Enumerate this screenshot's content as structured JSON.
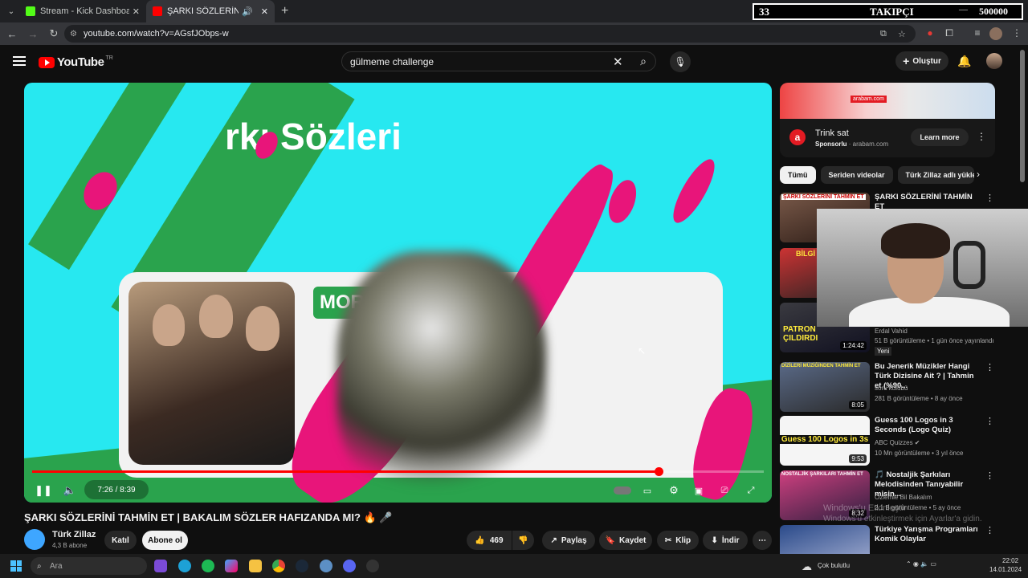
{
  "browser": {
    "tabs": [
      {
        "title": "Stream - Kick Dashboard",
        "color": "#53fc18"
      },
      {
        "title": "ŞARKI SÖZLERİNİ TAHMİN",
        "color": "#ff0000"
      }
    ],
    "url": "youtube.com/watch?v=AGsfJObps-w"
  },
  "follow_overlay": {
    "count": "33",
    "label": "TAKIPÇI",
    "goal": "500000"
  },
  "youtube": {
    "logo": "YouTube",
    "region": "TR",
    "search_value": "gülmeme challenge",
    "create_label": "Oluştur"
  },
  "player": {
    "overlay_title": "rkı Sözleri",
    "panel_text": "MOR VE",
    "time": "7:26 / 8:39",
    "progress": 0.856
  },
  "video": {
    "title": "ŞARKI SÖZLERİNİ TAHMİN ET | BAKALIM SÖZLER HAFIZANDA MI? 🔥 🎤",
    "channel": "Türk Zillaz",
    "subs": "4,3 B abone",
    "join": "Katıl",
    "subscribe": "Abone ol",
    "likes": "469",
    "share": "Paylaş",
    "save": "Kaydet",
    "clip": "Klip",
    "download": "İndir"
  },
  "ad": {
    "banner_text": "arabam.com",
    "title": "Trink sat",
    "sponsor": "Sponsorlu",
    "domain": "arabam.com",
    "cta": "Learn more"
  },
  "chips": [
    "Tümü",
    "Seriden videolar",
    "Türk Zillaz adlı yükle"
  ],
  "recommendations": [
    {
      "title": "ŞARKI SÖZLERİNİ TAHMİN ET",
      "thumb": "ŞARKI SÖZLERİNİ TAHMİN ET",
      "channel": "",
      "meta": "",
      "duration": ""
    },
    {
      "title": "",
      "thumb": "BİLGİ",
      "channel": "",
      "meta": "",
      "duration": ""
    },
    {
      "title": "",
      "thumb": "PATRON ÇILDIRDI",
      "channel": "Erdal Vahid",
      "meta": "51 B görüntüleme • 1 gün önce yayınlandı",
      "duration": "1:24:42",
      "badge": "Yeni"
    },
    {
      "title": "Bu Jenerik Müzikler Hangi Türk Dizisine Ait ? | Tahmin et (%90...",
      "thumb": "DİZİLERİ MÜZİĞİNDEN TAHMİN ET",
      "channel": "soru kulübü",
      "meta": "281 B görüntüleme • 8 ay önce",
      "duration": "8:05"
    },
    {
      "title": "Guess 100 Logos in 3 Seconds (Logo Quiz)",
      "thumb": "Guess 100 Logos in 3s",
      "channel": "ABC Quizzes ✔",
      "meta": "10 Mn görüntüleme • 3 yıl önce",
      "duration": "9:53"
    },
    {
      "title": "🎵 Nostaljik Şarkıları Melodisinden Tanıyabilir misin...",
      "thumb": "NOSTALJİK ŞARKILARI TAHMİN ET",
      "channel": "Özlemle Bil Bakalım",
      "meta": "2,1 B görüntüleme • 5 ay önce",
      "duration": "8:32"
    },
    {
      "title": "Türkiye Yarışma Programları Komik Olaylar",
      "thumb": "",
      "channel": "",
      "meta": "",
      "duration": ""
    }
  ],
  "watermark": [
    "Windows'u Etkinleştir",
    "Windows'u etkinleştirmek için Ayarlar'a gidin."
  ],
  "taskbar": {
    "search": "Ara",
    "time": "22:02",
    "date": "14.01.2024",
    "weather": "Çok bulutlu"
  }
}
